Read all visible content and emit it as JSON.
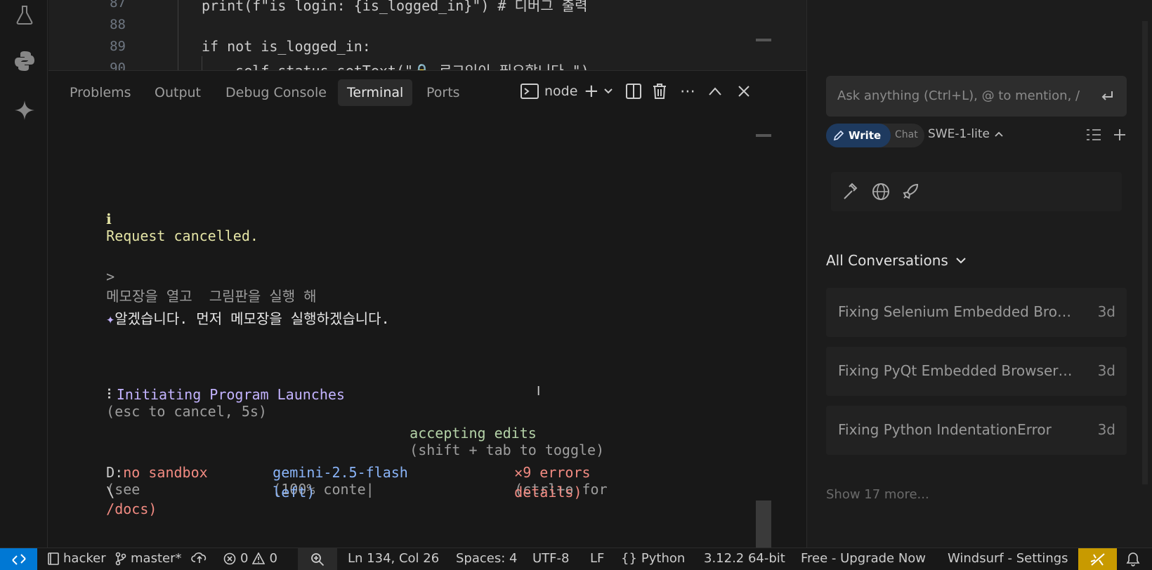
{
  "activity_bar": {
    "items": [
      "flask-icon",
      "python-icon",
      "sparkle-icon"
    ]
  },
  "editor": {
    "lines": [
      {
        "number": "87",
        "code": "print(f\"is login: {is_logged_in}\") # 디버그 출력"
      },
      {
        "number": "88",
        "code": ""
      },
      {
        "number": "89",
        "code": "if not is_logged_in:"
      },
      {
        "number": "90",
        "code": "    self.status.setText(\"🔒 로그인이 필요합니다.\")"
      }
    ]
  },
  "panel": {
    "tabs": [
      "Problems",
      "Output",
      "Debug Console",
      "Terminal",
      "Ports"
    ],
    "active_tab": "Terminal",
    "terminal_name": "node"
  },
  "terminal": {
    "info_icon": "ℹ",
    "info_text": "Request cancelled.",
    "prompt_symbol": ">",
    "user_input": "메모장을 열고  그림판을 실행 해",
    "reply_symbol": "✦",
    "reply_text": "알겠습니다. 먼저 메모장을 실행하겠습니다.",
    "spinner_symbol": "⠇",
    "status_main": "Initiating Program Launches",
    "status_hint": "(esc to cancel, 5s)",
    "mode_main": "accepting edits",
    "mode_hint": "(shift + tab to toggle)",
    "footer": {
      "dir_prefix": "D:",
      "sandbox": "no sandbox",
      "sandbox_hint_1": "(see",
      "path_line2_prefix": "\\",
      "sandbox_hint_2": "/docs)",
      "model": "gemini-2.5-flash",
      "context_1": "(100% conte",
      "context_2": "left)",
      "error_mark": "✕",
      "errors": "9 errors",
      "errors_hint_1": "(ctrl+o for",
      "errors_hint_2": "details)"
    }
  },
  "side": {
    "ask_placeholder": "Ask anything (Ctrl+L), @ to mention, /",
    "write_label": "Write",
    "chat_label": "Chat",
    "model": "SWE-1-lite",
    "conversations_header": "All Conversations",
    "conversations": [
      {
        "title": "Fixing Selenium Embedded Browser UI",
        "age": "3d"
      },
      {
        "title": "Fixing PyQt Embedded Browser UI",
        "age": "3d"
      },
      {
        "title": "Fixing Python IndentationError",
        "age": "3d"
      }
    ],
    "show_more": "Show 17 more..."
  },
  "status_bar": {
    "project": "hacker",
    "branch": "master*",
    "errors": "0",
    "warnings": "0",
    "position": "Ln 134, Col 26",
    "spaces": "Spaces: 4",
    "encoding": "UTF-8",
    "eol": "LF",
    "language": "Python",
    "interpreter": "3.12.2 64-bit",
    "upgrade": "Free - Upgrade Now",
    "windsurf": "Windsurf - Settings"
  },
  "colors": {
    "accent": "#0078d4",
    "terminal_info": "#e5e5a6",
    "terminal_purple": "#c3b3ff",
    "terminal_green": "#b5d3a8",
    "terminal_red": "#f28b82",
    "terminal_blue": "#8ab4f8",
    "windsurf_badge": "#c89a00"
  }
}
